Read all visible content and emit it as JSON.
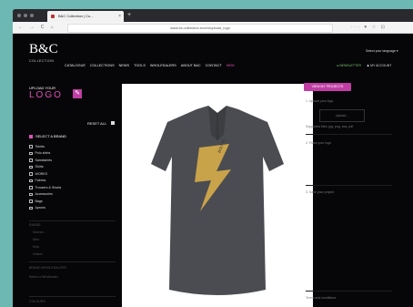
{
  "browser": {
    "tab_title": "B&C Collection | Cu...",
    "tab_close": "×",
    "new_tab": "+",
    "nav_buttons": "← → C ⌂",
    "url": "www.bc-collection.eu/en/upload_logo",
    "tools": "··· ♥ ☆ ⊡"
  },
  "header": {
    "logo": "B&C",
    "logo_sub": "COLLECTION",
    "lang": "Select your language ▾",
    "menu": [
      "CATALOGUE",
      "COLLECTIONS",
      "NEWS",
      "TOOLS",
      "WHOLESALERS",
      "ABOUT B&C",
      "CONTACT",
      "NEW"
    ],
    "account": [
      "● NEWSLETTER",
      "♟ MY ACCOUNT"
    ]
  },
  "sidebar": {
    "upload_small": "UPLOAD YOUR",
    "upload_big": "LOGO",
    "upload_icon": "✎",
    "reset": "RESET ALL",
    "filter_title": "SELECT A BRAND",
    "brands": [
      "Tshirts",
      "Polo shirts",
      "Sweatshirts",
      "Shirts",
      "WORKS",
      "Fabrics",
      "Trousers & Shorts",
      "Accessories",
      "Bags",
      "Aprons"
    ],
    "section_more": "RANGE",
    "more_items": [
      "Women",
      "Men",
      "Kids",
      "Unisex"
    ],
    "brand_wholesale": "BRAND WHOLESALERS",
    "brand_sub": "Select a Wholesaler",
    "colour": "COLOURS"
  },
  "product": {
    "shirt_color": "#4b4c51",
    "bolt_color": "#c9a34a",
    "print_text": "BOLT 01"
  },
  "right": {
    "view_button": "VIEW MY PROJECTS",
    "step1": "1. Upload your logo",
    "upload_btn": "Upload...",
    "supported": "Supported files: jpg, png, eps, pdf",
    "step2": "2. Place your logo",
    "step3": "3. Save your project",
    "foot": "Terms and conditions"
  }
}
